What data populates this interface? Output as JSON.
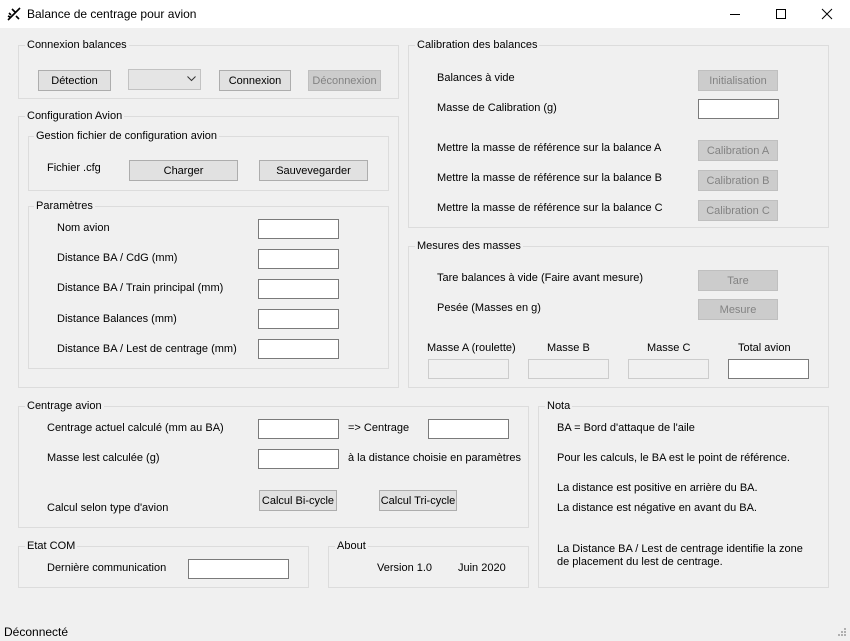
{
  "window": {
    "title": "Balance de centrage pour avion",
    "status": "Déconnecté"
  },
  "connexion": {
    "legend": "Connexion balances",
    "detection": "Détection",
    "port_value": "",
    "connect": "Connexion",
    "disconnect": "Déconnexion"
  },
  "config": {
    "legend": "Configuration Avion",
    "file_group": "Gestion fichier de configuration avion",
    "file_label": "Fichier .cfg",
    "load": "Charger",
    "save": "Sauvevegarder",
    "params_legend": "Paramètres",
    "params": {
      "nom": "Nom avion",
      "cdg": "Distance BA / CdG (mm)",
      "train": "Distance BA / Train principal (mm)",
      "balances": "Distance Balances (mm)",
      "lest": "Distance BA / Lest de centrage (mm)"
    }
  },
  "calibration": {
    "legend": "Calibration des balances",
    "empty": "Balances à vide",
    "init": "Initialisation",
    "mass_label": "Masse de Calibration (g)",
    "ref_a": "Mettre la masse de référence sur la balance A",
    "cal_a": "Calibration A",
    "ref_b": "Mettre la masse de référence sur la balance B",
    "cal_b": "Calibration B",
    "ref_c": "Mettre la masse de référence sur la balance C",
    "cal_c": "Calibration C"
  },
  "mesures": {
    "legend": "Mesures des masses",
    "tare_label": "Tare balances à vide (Faire avant mesure)",
    "tare": "Tare",
    "pesee_label": "Pesée (Masses en g)",
    "mesure": "Mesure",
    "mass_a": "Masse A (roulette)",
    "mass_b": "Masse B",
    "mass_c": "Masse C",
    "total": "Total avion"
  },
  "centrage": {
    "legend": "Centrage avion",
    "actual": "Centrage actuel calculé (mm au BA)",
    "arrow": "=> Centrage",
    "lest": "Masse lest calculée (g)",
    "lest_note": "à la distance choisie en paramètres",
    "type": "Calcul selon type d'avion",
    "bicycle": "Calcul Bi-cycle",
    "tricycle": "Calcul Tri-cycle"
  },
  "nota": {
    "legend": "Nota",
    "line1": "BA = Bord d'attaque de l'aile",
    "line2": "Pour les calculs, le BA est le  point de référence.",
    "line3": "La distance est positive en arrière du BA.",
    "line4": "La distance est négative en avant du BA.",
    "line5": "La Distance BA / Lest de centrage identifie la zone",
    "line6": "de placement du lest de centrage."
  },
  "com": {
    "legend": "Etat COM",
    "last": "Dernière communication"
  },
  "about": {
    "legend": "About",
    "version": "Version 1.0",
    "date": "Juin 2020"
  },
  "icons": {
    "app": "airplane-icon",
    "minimize": "minimize-icon",
    "maximize": "maximize-icon",
    "close": "close-icon",
    "dropdown": "chevron-down-icon"
  }
}
